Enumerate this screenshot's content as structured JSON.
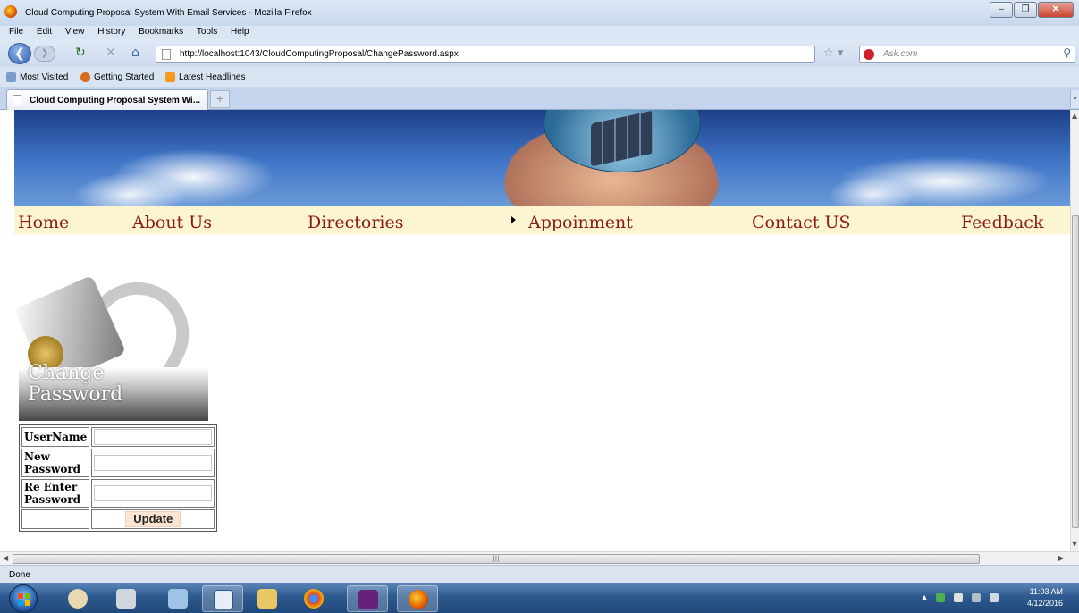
{
  "window": {
    "title": "Cloud Computing Proposal System With Email Services - Mozilla Firefox",
    "controls": [
      "minimize",
      "maximize",
      "close"
    ]
  },
  "menubar": [
    "File",
    "Edit",
    "View",
    "History",
    "Bookmarks",
    "Tools",
    "Help"
  ],
  "navbar": {
    "url": "http://localhost:1043/CloudComputingProposal/ChangePassword.aspx",
    "search_placeholder": "Ask.com"
  },
  "bookmarks": [
    "Most Visited",
    "Getting Started",
    "Latest Headlines"
  ],
  "tab": {
    "title": "Cloud Computing Proposal System Wi..."
  },
  "site_menu": [
    "Home",
    "About Us",
    "Directories",
    "Appoinment",
    "Contact US",
    "Feedback"
  ],
  "change_password": {
    "heading_line1": "Change",
    "heading_line2": "Password",
    "labels": {
      "username": "UserName",
      "new_password_1": "New",
      "new_password_2": "Password",
      "reenter_1": "Re Enter",
      "reenter_2": "Password"
    },
    "values": {
      "username": "",
      "new_password": "",
      "reenter_password": ""
    },
    "update_label": "Update"
  },
  "statusbar": {
    "text": "Done"
  },
  "taskbar": {
    "apps": [
      "windows-explorer",
      "paint",
      "calculator",
      "generic-app",
      "word",
      "file-explorer",
      "chrome",
      "visual-studio",
      "firefox"
    ],
    "active_app": "firefox",
    "time": "11:03 AM",
    "date": "4/12/2016"
  },
  "colors": {
    "menu_bg": "#fdf5d2",
    "menu_text": "#8b1b12",
    "update_bg": "#fbe5d2"
  }
}
